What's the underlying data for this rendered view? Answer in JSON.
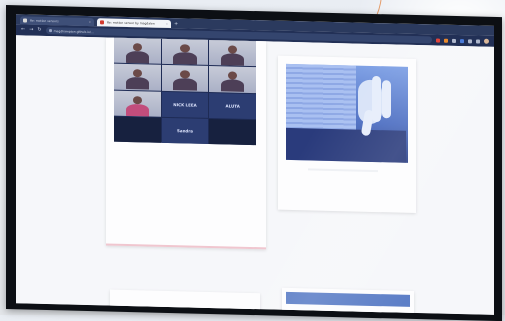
{
  "browser": {
    "tabs": [
      {
        "title": "Re: motion sensors"
      },
      {
        "title": "Re: motion sensor by magdalen"
      }
    ],
    "url": "magdhampton.github.io/..."
  },
  "call_grid": {
    "tiles": [
      {
        "kind": "photo"
      },
      {
        "kind": "photo"
      },
      {
        "kind": "photo"
      },
      {
        "kind": "photo"
      },
      {
        "kind": "photo"
      },
      {
        "kind": "photo"
      },
      {
        "kind": "photo"
      },
      {
        "kind": "name",
        "label": "NICK LEEA"
      },
      {
        "kind": "name",
        "label": "ALUTA"
      },
      {
        "kind": "dark"
      },
      {
        "kind": "name",
        "label": "Sandra"
      },
      {
        "kind": "dark"
      }
    ]
  },
  "colors": {
    "screen_chrome": "#223056",
    "grid_bg": "#1e2b55",
    "photo_blue": "#4a6cc1"
  }
}
